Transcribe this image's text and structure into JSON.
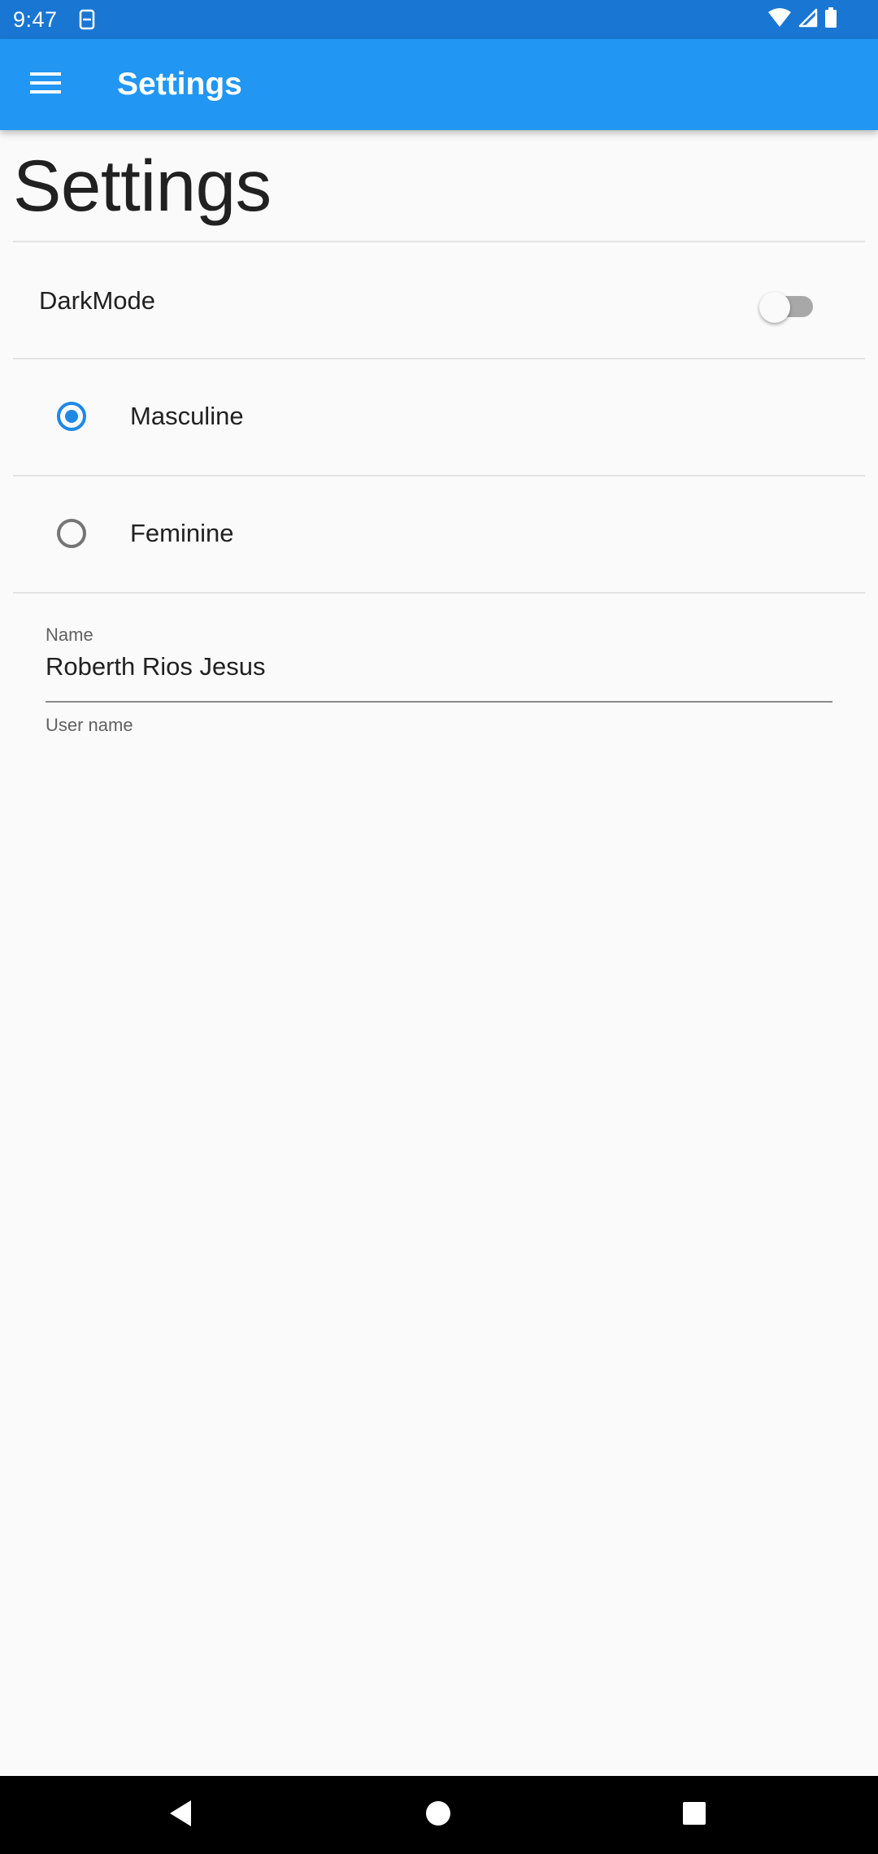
{
  "status_bar": {
    "time": "9:47",
    "icons": [
      "sim-card-icon",
      "wifi-icon",
      "cell-signal-icon",
      "battery-icon"
    ]
  },
  "app_bar": {
    "title": "Settings",
    "menu_icon": "hamburger-menu-icon",
    "background": "#2196f3"
  },
  "page": {
    "heading": "Settings"
  },
  "settings": {
    "dark_mode": {
      "label": "DarkMode",
      "enabled": false
    },
    "gender": {
      "options": [
        {
          "label": "Masculine",
          "selected": true
        },
        {
          "label": "Feminine",
          "selected": false
        }
      ]
    },
    "name_field": {
      "label": "Name",
      "value": "Roberth Rios Jesus",
      "helper": "User name"
    }
  },
  "navigation_bar": {
    "buttons": [
      "back-icon",
      "home-icon",
      "recents-icon"
    ]
  },
  "colors": {
    "accent": "#1e88e5",
    "status_bar": "#1976d2",
    "background": "#fafafa"
  }
}
